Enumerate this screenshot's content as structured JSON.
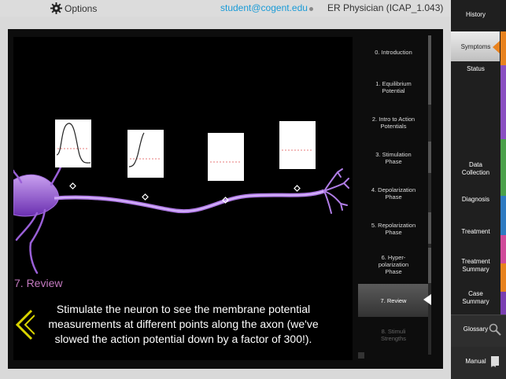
{
  "topbar": {
    "options_label": "Options",
    "email": "student@cogent.edu",
    "role": "ER Physician (ICAP_1.043)"
  },
  "chapters": [
    {
      "label": "0. Introduction",
      "state": "normal"
    },
    {
      "label": "1. Equilibrium\nPotential",
      "state": "normal"
    },
    {
      "label": "2. Intro to Action\nPotentials",
      "state": "normal"
    },
    {
      "label": "3. Stimulation\nPhase",
      "state": "normal"
    },
    {
      "label": "4. Depolarization\nPhase",
      "state": "normal"
    },
    {
      "label": "5. Repolarization\nPhase",
      "state": "normal"
    },
    {
      "label": "6. Hyper-\npolarization\nPhase",
      "state": "normal"
    },
    {
      "label": "7. Review",
      "state": "active"
    },
    {
      "label": "8. Stimuli\nStrengths",
      "state": "dim"
    }
  ],
  "review": {
    "title": "7.  Review",
    "caption": "Stimulate the neuron to see the membrane potential measurements at different points along the axon (we've slowed the action potential down by a factor of 300!)."
  },
  "sidebar": {
    "items": [
      {
        "label": "History"
      },
      {
        "label": "Symptoms"
      },
      {
        "label": "Status"
      },
      {
        "label": "Data\nCollection"
      },
      {
        "label": "Diagnosis"
      },
      {
        "label": "Treatment"
      },
      {
        "label": "Treatment\nSummary"
      },
      {
        "label": "Case\nSummary"
      },
      {
        "label": "Glossary"
      },
      {
        "label": "Manual"
      }
    ],
    "active": "Symptoms"
  },
  "colors": {
    "accent_orange": "#e8821e",
    "email_blue": "#1a9bd7",
    "review_pink": "#c47ac0",
    "neuron_purple": "#8a4fc2",
    "chevron_yellow": "#d9d400"
  },
  "icons": [
    "gear-icon",
    "search-icon",
    "book-icon",
    "chevron-left-icon"
  ]
}
